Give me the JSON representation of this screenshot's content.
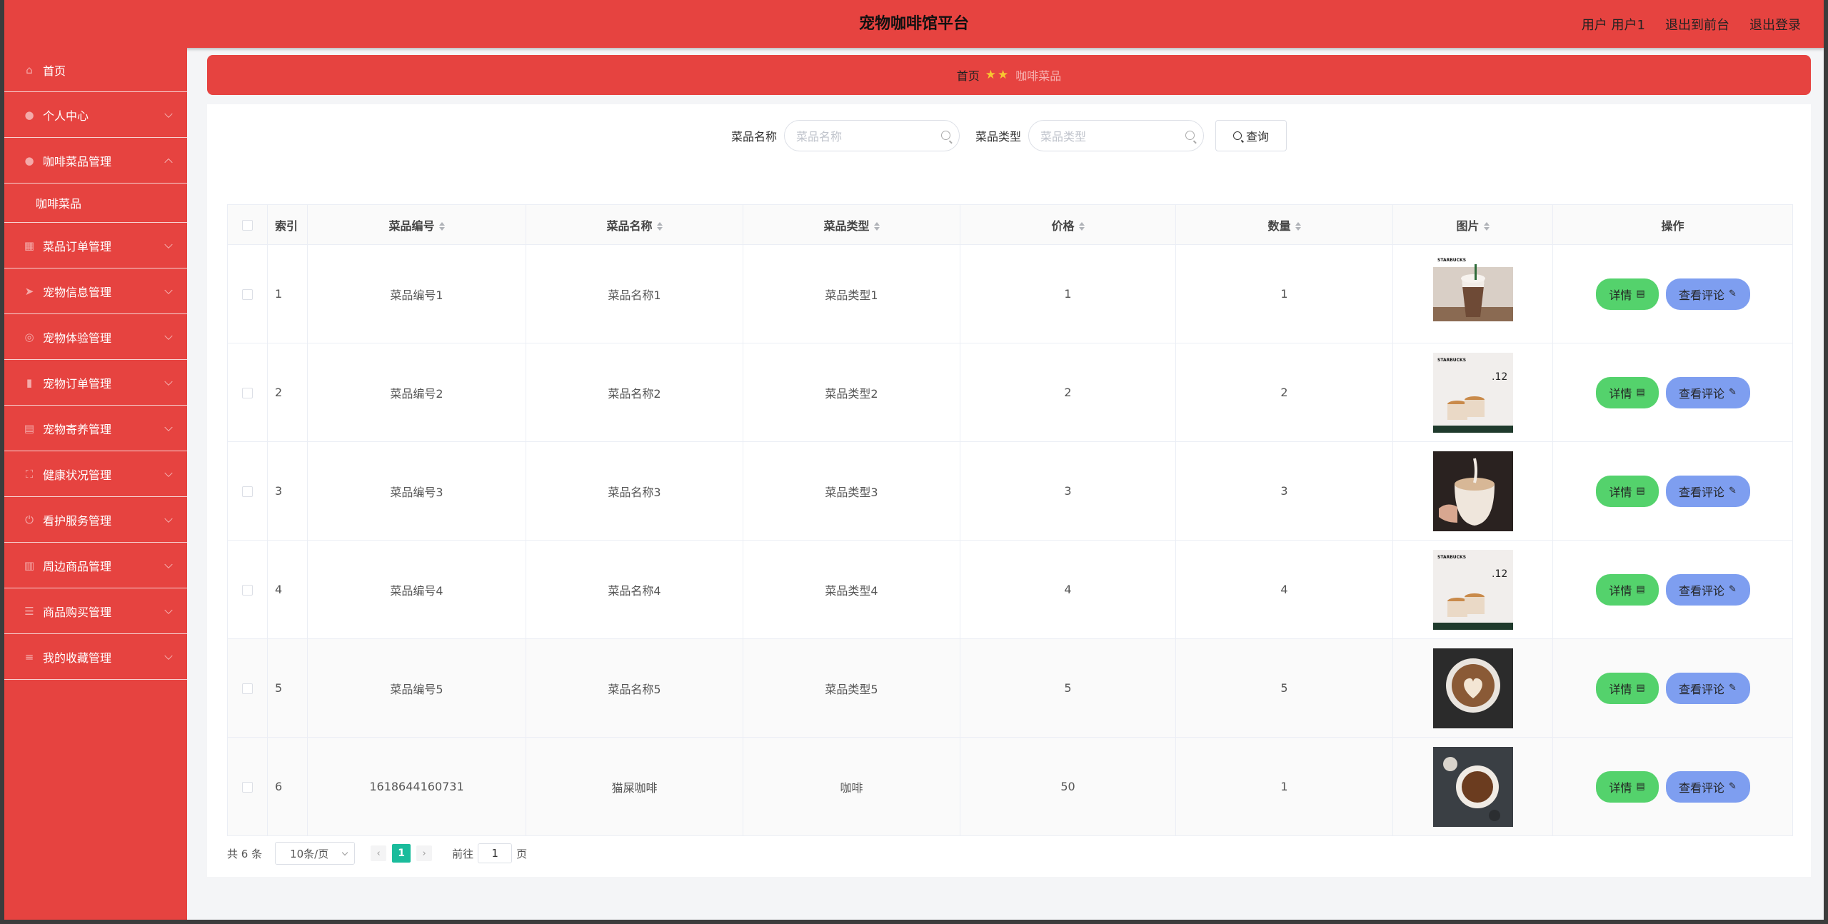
{
  "header": {
    "title": "宠物咖啡馆平台",
    "user": "用户 用户1",
    "front": "退出到前台",
    "logout": "退出登录"
  },
  "sidebar": {
    "items": [
      {
        "label": "首页",
        "icon": "home-icon",
        "expandable": false
      },
      {
        "label": "个人中心",
        "icon": "user-icon",
        "expandable": true
      },
      {
        "label": "咖啡菜品管理",
        "icon": "user-icon",
        "expandable": true,
        "expanded": true,
        "children": [
          "咖啡菜品"
        ]
      },
      {
        "label": "菜品订单管理",
        "icon": "grid-icon",
        "expandable": true
      },
      {
        "label": "宠物信息管理",
        "icon": "send-icon",
        "expandable": true
      },
      {
        "label": "宠物体验管理",
        "icon": "globe-icon",
        "expandable": true
      },
      {
        "label": "宠物订单管理",
        "icon": "mic-icon",
        "expandable": true
      },
      {
        "label": "宠物寄养管理",
        "icon": "calendar-icon",
        "expandable": true
      },
      {
        "label": "健康状况管理",
        "icon": "frame-icon",
        "expandable": true
      },
      {
        "label": "看护服务管理",
        "icon": "power-icon",
        "expandable": true
      },
      {
        "label": "周边商品管理",
        "icon": "chart-icon",
        "expandable": true
      },
      {
        "label": "商品购买管理",
        "icon": "sliders-icon",
        "expandable": true
      },
      {
        "label": "我的收藏管理",
        "icon": "list-icon",
        "expandable": true
      }
    ]
  },
  "breadcrumb": {
    "home": "首页",
    "stars": "★★",
    "current": "咖啡菜品"
  },
  "search": {
    "name_label": "菜品名称",
    "name_placeholder": "菜品名称",
    "type_label": "菜品类型",
    "type_placeholder": "菜品类型",
    "query_label": "查询"
  },
  "table": {
    "headers": {
      "index": "索引",
      "code": "菜品编号",
      "name": "菜品名称",
      "type": "菜品类型",
      "price": "价格",
      "qty": "数量",
      "image": "图片",
      "ops": "操作"
    },
    "rows": [
      {
        "index": "1",
        "code": "菜品编号1",
        "name": "菜品名称1",
        "type": "菜品类型1",
        "price": "1",
        "qty": "1",
        "image": "iced-coffee"
      },
      {
        "index": "2",
        "code": "菜品编号2",
        "name": "菜品名称2",
        "type": "菜品类型2",
        "price": "2",
        "qty": "2",
        "image": "starbucks-promo"
      },
      {
        "index": "3",
        "code": "菜品编号3",
        "name": "菜品名称3",
        "type": "菜品类型3",
        "price": "3",
        "qty": "3",
        "image": "latte-pour"
      },
      {
        "index": "4",
        "code": "菜品编号4",
        "name": "菜品名称4",
        "type": "菜品类型4",
        "price": "4",
        "qty": "4",
        "image": "starbucks-promo"
      },
      {
        "index": "5",
        "code": "菜品编号5",
        "name": "菜品名称5",
        "type": "菜品类型5",
        "price": "5",
        "qty": "5",
        "image": "latte-art"
      },
      {
        "index": "6",
        "code": "1618644160731",
        "name": "猫屎咖啡",
        "type": "咖啡",
        "price": "50",
        "qty": "1",
        "image": "black-coffee"
      }
    ],
    "detail_label": "详情",
    "review_label": "查看评论"
  },
  "pagination": {
    "total": "共 6 条",
    "page_size": "10条/页",
    "current": "1",
    "goto_prefix": "前往",
    "goto_value": "1",
    "goto_suffix": "页"
  },
  "starbucks_text": {
    "brand": "STARBUCKS",
    "date": ".12"
  },
  "colors": {
    "brand_red": "#e64340",
    "detail_green": "#54d26c",
    "review_blue": "#7e9ef0",
    "page_active": "#1abc9c"
  }
}
